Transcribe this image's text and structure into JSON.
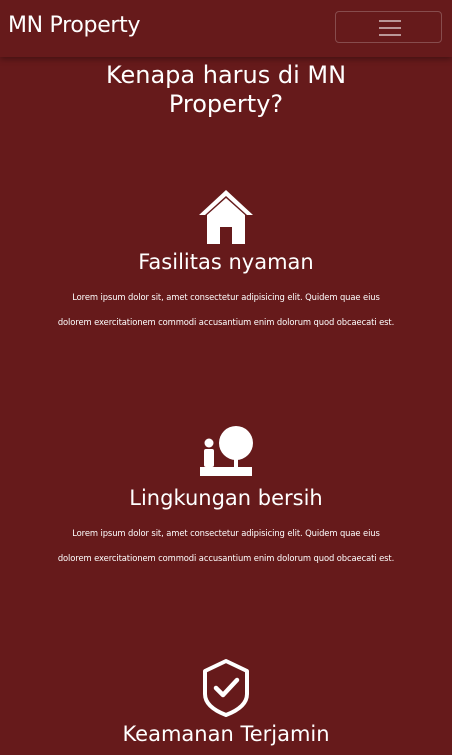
{
  "navbar": {
    "brand": "MN Property",
    "toggler_icon": "hamburger-menu-icon"
  },
  "section": {
    "title": "Kenapa harus di MN Property?"
  },
  "features": [
    {
      "icon": "house-icon",
      "title": "Fasilitas nyaman",
      "description": "Lorem ipsum dolor sit, amet consectetur adipisicing elit. Quidem quae eius dolorem exercitationem commodi accusantium enim dolorum quod obcaecati est."
    },
    {
      "icon": "person-tree-icon",
      "title": "Lingkungan bersih",
      "description": "Lorem ipsum dolor sit, amet consectetur adipisicing elit. Quidem quae eius dolorem exercitationem commodi accusantium enim dolorum quod obcaecati est."
    },
    {
      "icon": "shield-check-icon",
      "title": "Keamanan Terjamin",
      "description": ""
    }
  ],
  "colors": {
    "background": "#661a1b",
    "text": "#ffffff"
  }
}
